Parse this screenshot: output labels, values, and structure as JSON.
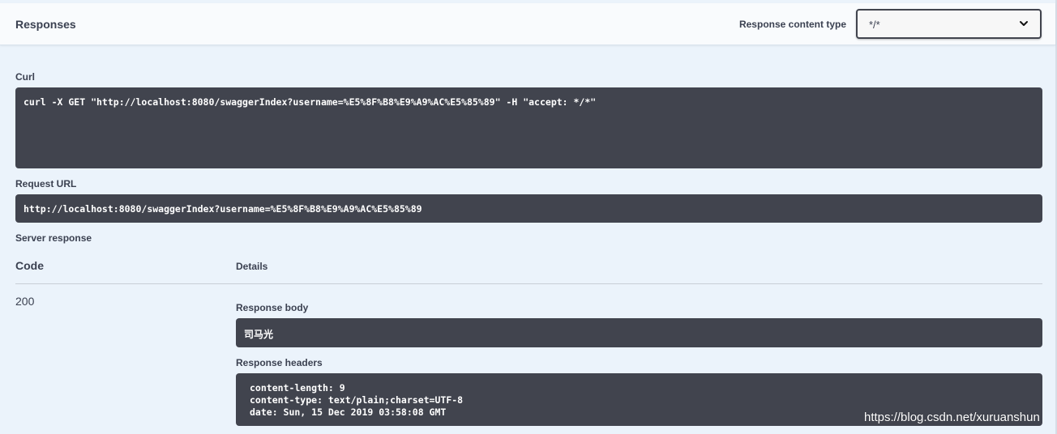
{
  "responses": {
    "title": "Responses",
    "content_type_label": "Response content type",
    "content_type_value": "*/*"
  },
  "curl": {
    "label": "Curl",
    "command": "curl -X GET \"http://localhost:8080/swaggerIndex?username=%E5%8F%B8%E9%A9%AC%E5%85%89\" -H \"accept: */*\""
  },
  "request_url": {
    "label": "Request URL",
    "value": "http://localhost:8080/swaggerIndex?username=%E5%8F%B8%E9%A9%AC%E5%85%89"
  },
  "server_response": {
    "label": "Server response",
    "code_header": "Code",
    "details_header": "Details",
    "status_code": "200",
    "body_label": "Response body",
    "body_value": "司马光",
    "headers_label": "Response headers",
    "headers": [
      "content-length: 9",
      "content-type: text/plain;charset=UTF-8",
      "date: Sun, 15 Dec 2019 03:58:08 GMT"
    ]
  },
  "watermark": "https://blog.csdn.net/xuruanshun",
  "colors": {
    "page_background": "#ebf3fb",
    "code_background": "#41444e",
    "text": "#3b4151"
  },
  "icons": {
    "select_chevron": "chevron-down-icon"
  }
}
